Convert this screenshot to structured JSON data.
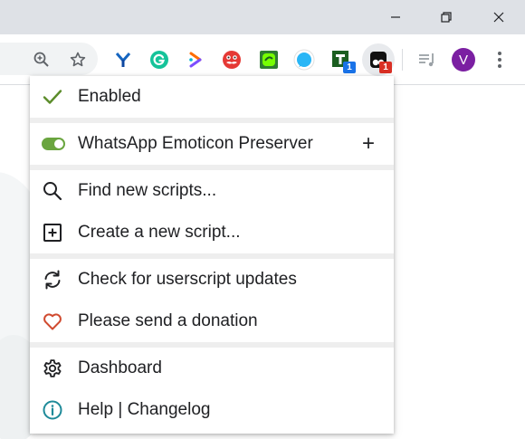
{
  "browser": {
    "avatar_initial": "V",
    "extension_badges": {
      "green_t": "1",
      "tampermonkey": "1"
    },
    "colors": {
      "titlebar": "#dee1e6",
      "toolbar": "#ffffff",
      "avatar": "#7b1fa2",
      "badge_blue": "#1a73e8",
      "badge_red": "#d93025"
    }
  },
  "menu": {
    "enabled_label": "Enabled",
    "script": {
      "name": "WhatsApp Emoticon Preserver",
      "plus_label": "+",
      "toggle_on": true
    },
    "find_scripts_label": "Find new scripts...",
    "create_script_label": "Create a new script...",
    "check_updates_label": "Check for userscript updates",
    "donation_label": "Please send a donation",
    "dashboard_label": "Dashboard",
    "help_label": "Help | Changelog",
    "colors": {
      "check": "#5b8c2a",
      "toggle": "#6aa53f",
      "heart": "#d04a2f",
      "info": "#1e8a99",
      "separator": "#eeeeee"
    },
    "icons": {
      "enabled": "check-icon",
      "toggle": "toggle-switch-icon",
      "find": "search-icon",
      "create": "plus-square-icon",
      "updates": "refresh-icon",
      "donation": "heart-icon",
      "dashboard": "gear-icon",
      "help": "info-icon"
    }
  }
}
